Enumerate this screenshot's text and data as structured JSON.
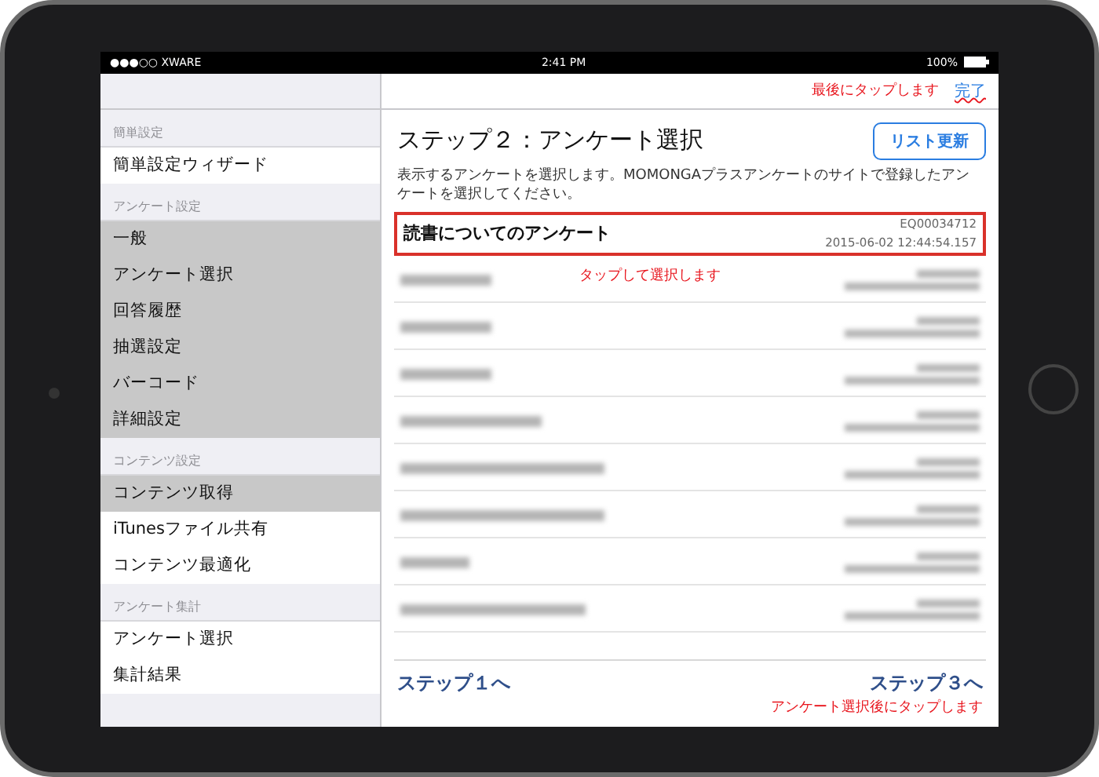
{
  "status_bar": {
    "carrier": "●●●○○ XWARE",
    "time": "2:41 PM",
    "battery": "100%"
  },
  "sidebar": {
    "sections": [
      {
        "header": "簡単設定",
        "items": [
          {
            "label": "簡単設定ウィザード",
            "selected": false
          }
        ]
      },
      {
        "header": "アンケート設定",
        "items": [
          {
            "label": "一般",
            "selected": true
          },
          {
            "label": "アンケート選択",
            "selected": true
          },
          {
            "label": "回答履歴",
            "selected": true
          },
          {
            "label": "抽選設定",
            "selected": true
          },
          {
            "label": "バーコード",
            "selected": true
          },
          {
            "label": "詳細設定",
            "selected": true
          }
        ]
      },
      {
        "header": "コンテンツ設定",
        "items": [
          {
            "label": "コンテンツ取得",
            "selected": true
          },
          {
            "label": "iTunesファイル共有",
            "selected": false
          },
          {
            "label": "コンテンツ最適化",
            "selected": false
          }
        ]
      },
      {
        "header": "アンケート集計",
        "items": [
          {
            "label": "アンケート選択",
            "selected": false
          },
          {
            "label": "集計結果",
            "selected": false
          }
        ]
      }
    ]
  },
  "nav": {
    "note": "最後にタップします",
    "done": "完了"
  },
  "main": {
    "title": "ステップ２：アンケート選択",
    "refresh_button": "リスト更新",
    "description": "表示するアンケートを選択します。MOMONGAプラスアンケートのサイトで登録したアンケートを選択してください。",
    "rows": [
      {
        "kind": "entry",
        "title": "読書についてのアンケート",
        "id": "EQ00034712",
        "date": "2015-06-02 12:44:54.157",
        "selected": true
      },
      {
        "kind": "blurred",
        "selected": false
      },
      {
        "kind": "blurred",
        "selected": false
      },
      {
        "kind": "blurred",
        "selected": false
      },
      {
        "kind": "blurred",
        "selected": false
      },
      {
        "kind": "blurred",
        "selected": false
      },
      {
        "kind": "blurred",
        "selected": false
      },
      {
        "kind": "blurred",
        "selected": false
      },
      {
        "kind": "blurred",
        "selected": false
      }
    ],
    "row_note": "タップして選択します",
    "back": "ステップ１へ",
    "next": "ステップ３へ",
    "next_note": "アンケート選択後にタップします"
  }
}
